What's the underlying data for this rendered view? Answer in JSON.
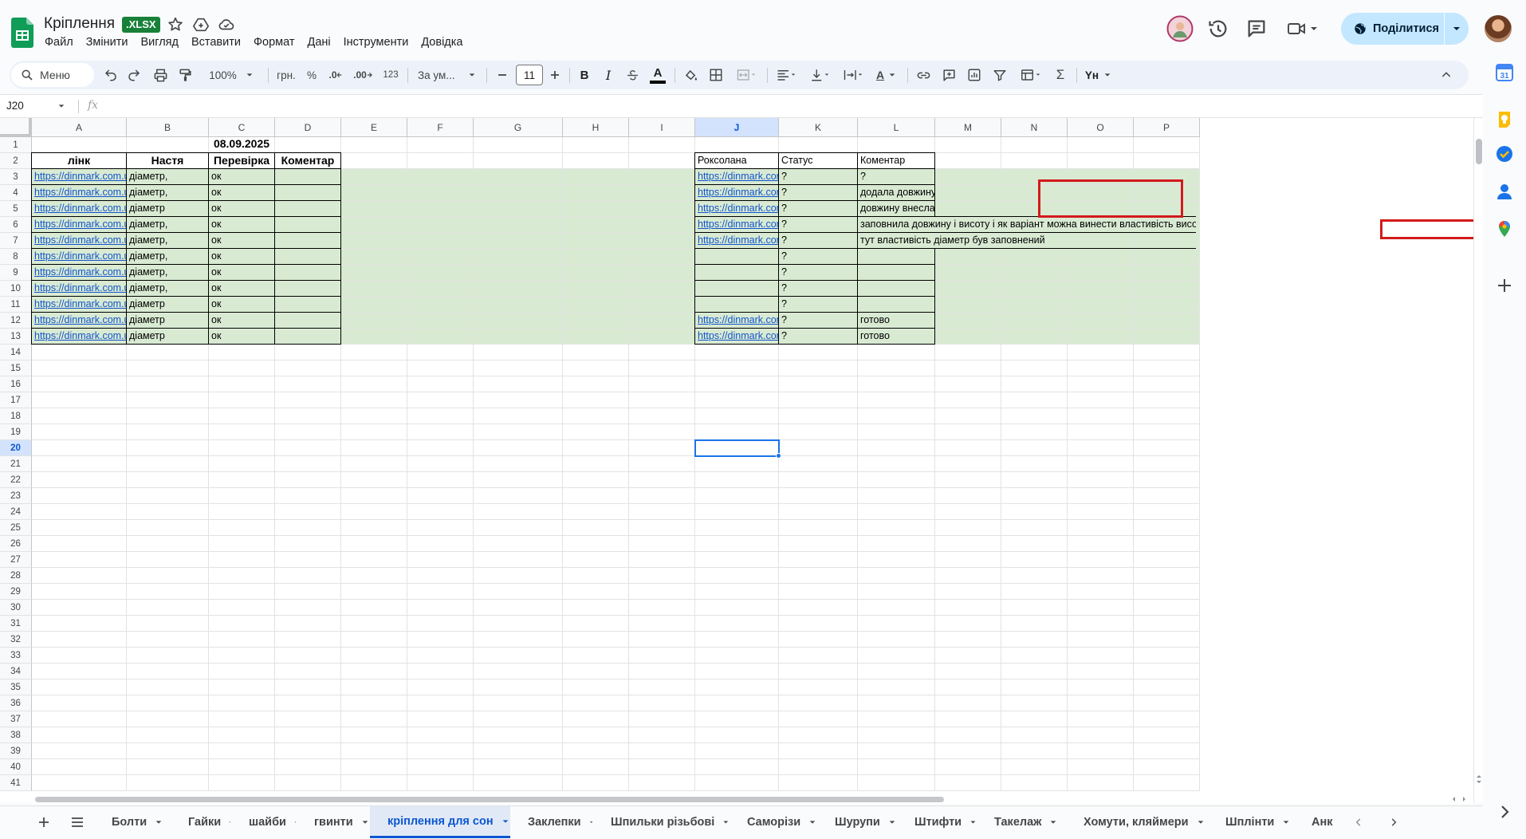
{
  "doc": {
    "title": "Кріплення",
    "badge": ".XLSX"
  },
  "menu": [
    "Файл",
    "Змінити",
    "Вигляд",
    "Вставити",
    "Формат",
    "Дані",
    "Інструменти",
    "Довідка"
  ],
  "share": {
    "label": "Поділитися"
  },
  "toolbar": {
    "menu_search": "Меню",
    "zoom": "100%",
    "currency": "грн.",
    "percent": "%",
    "dec_decrease": ".0",
    "dec_increase": ".00",
    "num_format": "123",
    "font": "За ум...",
    "font_size": "11",
    "bold": "B",
    "italic": "I",
    "text_color": "A",
    "text_rotate": "A",
    "sigma": "Σ",
    "input_tools": "Yн"
  },
  "formula_bar": {
    "name_box": "J20",
    "fx": "fx",
    "value": ""
  },
  "columns": [
    "A",
    "B",
    "C",
    "D",
    "E",
    "F",
    "G",
    "H",
    "I",
    "J",
    "K",
    "L",
    "M",
    "N",
    "O",
    "P"
  ],
  "selected": {
    "col": "J",
    "row": 20
  },
  "rows": [
    "1",
    "2",
    "3",
    "4",
    "5",
    "6",
    "7",
    "8",
    "9",
    "10",
    "11",
    "12",
    "13",
    "14",
    "15",
    "16",
    "17",
    "18",
    "19",
    "20",
    "21",
    "22",
    "23",
    "24",
    "25",
    "26",
    "27",
    "28",
    "29",
    "30",
    "31",
    "32",
    "33",
    "34",
    "35",
    "36",
    "37",
    "38",
    "39",
    "40",
    "41"
  ],
  "table_left": {
    "date": "08.09.2025",
    "headers": [
      "лінк",
      "Настя",
      "Перевірка",
      "Коментар"
    ],
    "rows": [
      [
        "https://dinmark.com.ua/s",
        "діаметр,",
        "ок",
        ""
      ],
      [
        "https://dinmark.com.ua/s",
        "діаметр,",
        "ок",
        ""
      ],
      [
        "https://dinmark.com.ua/s",
        "діаметр",
        "ок",
        ""
      ],
      [
        "https://dinmark.com.ua/s",
        "діаметр,",
        "ок",
        ""
      ],
      [
        "https://dinmark.com.ua/s",
        "діаметр,",
        "ок",
        ""
      ],
      [
        "https://dinmark.com.ua/s",
        "діаметр,",
        "ок",
        ""
      ],
      [
        "https://dinmark.com.ua/s",
        "діаметр,",
        "ок",
        ""
      ],
      [
        "https://dinmark.com.ua/s",
        "діаметр,",
        "ок",
        ""
      ],
      [
        "https://dinmark.com.ua/s",
        "діаметр",
        "ок",
        ""
      ],
      [
        "https://dinmark.com.ua/s",
        "діаметр",
        "ок",
        ""
      ],
      [
        "https://dinmark.com.ua/s",
        "діаметр",
        "ок",
        ""
      ]
    ]
  },
  "table_right": {
    "headers": [
      "Роксолана",
      "Статус",
      "Коментар"
    ],
    "rows": [
      [
        "https://dinmark.com",
        "?",
        "?"
      ],
      [
        "https://dinmark.com",
        "?",
        "додала довжину"
      ],
      [
        "https://dinmark.com",
        "?",
        "довжину внесла"
      ],
      [
        "https://dinmark.com",
        "?",
        "заповнила довжину і висоту і як варіант можна винести властивість висота, довжина"
      ],
      [
        "https://dinmark.com",
        "?",
        "тут властивість діаметр був заповнений"
      ],
      [
        "",
        "?",
        ""
      ],
      [
        "",
        "?",
        ""
      ],
      [
        "",
        "?",
        ""
      ],
      [
        "",
        "?",
        ""
      ],
      [
        "https://dinmark.com",
        "?",
        "готово"
      ],
      [
        "https://dinmark.com",
        "?",
        "готово"
      ]
    ]
  },
  "sheet_tabs": [
    "Болти",
    "Гайки",
    "шайби",
    "гвинти",
    "кріплення для сон",
    "Заклепки",
    "Шпильки різьбові",
    "Саморізи",
    "Шурупи",
    "Штифти",
    "Такелаж",
    "Хомути, кляймери",
    "Шплінти",
    "Анк"
  ],
  "active_tab": "кріплення для сон",
  "colors": {
    "accent": "#0b57d0",
    "green_fill": "#d9ead3",
    "share_bg": "#c2e7ff",
    "annotation_red": "#d21b1b",
    "xlsx_badge": "#188038"
  }
}
